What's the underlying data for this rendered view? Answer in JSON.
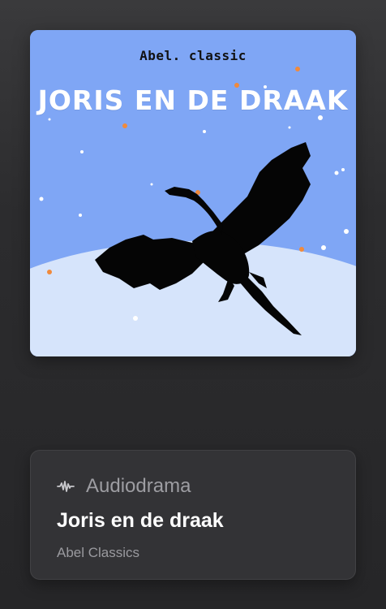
{
  "cover": {
    "brand": "Abel. classic",
    "title": "JORIS EN DE DRAAK",
    "background_color": "#7fa6f5",
    "accent_color": "#f08a3c"
  },
  "info": {
    "type_icon": "audio-waveform-icon",
    "type_label": "Audiodrama",
    "title": "Joris en de draak",
    "author": "Abel Classics"
  }
}
